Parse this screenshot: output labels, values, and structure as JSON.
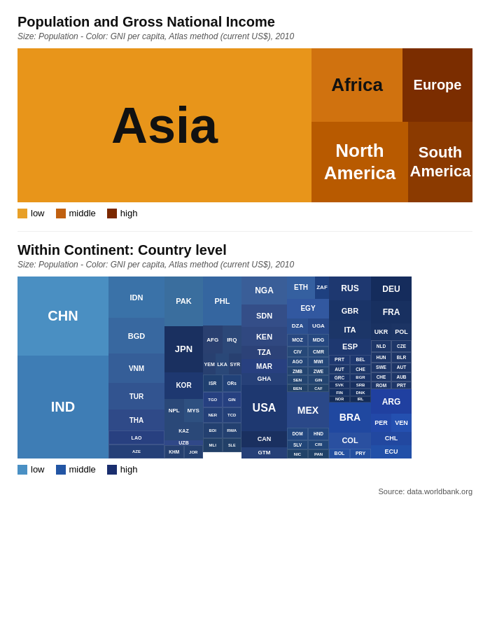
{
  "chart1": {
    "title": "Population and Gross National Income",
    "subtitle": "Size: Population - Color: GNI per capita, Atlas method (current US$), 2010",
    "regions": {
      "asia": "Asia",
      "africa": "Africa",
      "europe": "Europe",
      "north_america": "North\nAmerica",
      "south_america": "South\nAmerica"
    },
    "legend": {
      "low": "low",
      "middle": "middle",
      "high": "high"
    },
    "colors": {
      "low": "#E8A028",
      "middle": "#C06010",
      "high": "#7B2800"
    }
  },
  "chart2": {
    "title": "Within Continent: Country level",
    "subtitle": "Size: Population - Color: GNI per capita, Atlas method (current US$), 2010",
    "legend": {
      "low": "low",
      "middle": "middle",
      "high": "high"
    },
    "colors": {
      "low": "#4A90C4",
      "middle": "#2255A4",
      "high": "#1A2E6E"
    },
    "source": "Source: data.worldbank.org"
  }
}
